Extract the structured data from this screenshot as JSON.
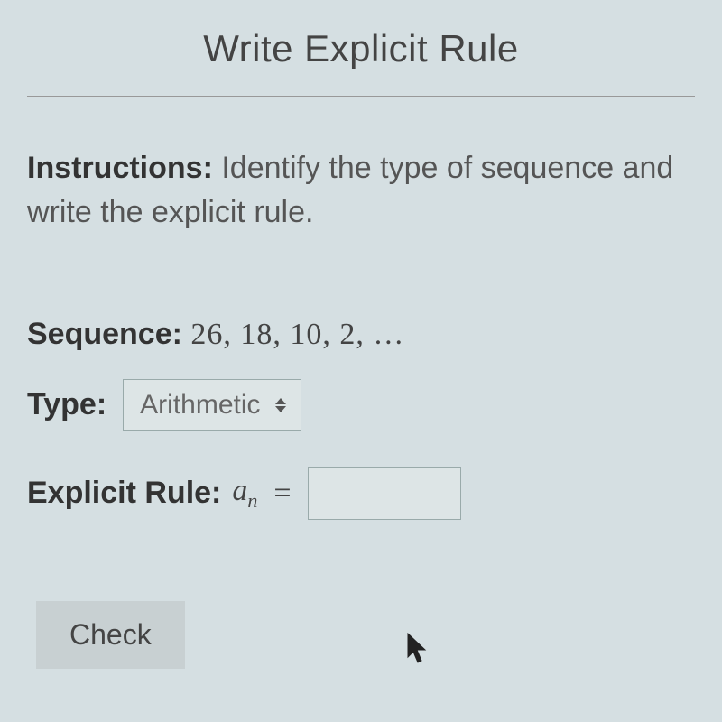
{
  "title": "Write Explicit Rule",
  "instructions": {
    "label": "Instructions:",
    "text": "Identify the type of sequence and write the explicit rule."
  },
  "sequence": {
    "label": "Sequence:",
    "value": "26, 18, 10, 2, …"
  },
  "type": {
    "label": "Type:",
    "selected": "Arithmetic"
  },
  "explicit": {
    "label": "Explicit Rule:",
    "variable": "a",
    "subscript": "n",
    "equals": "=",
    "value": ""
  },
  "check_button": "Check"
}
